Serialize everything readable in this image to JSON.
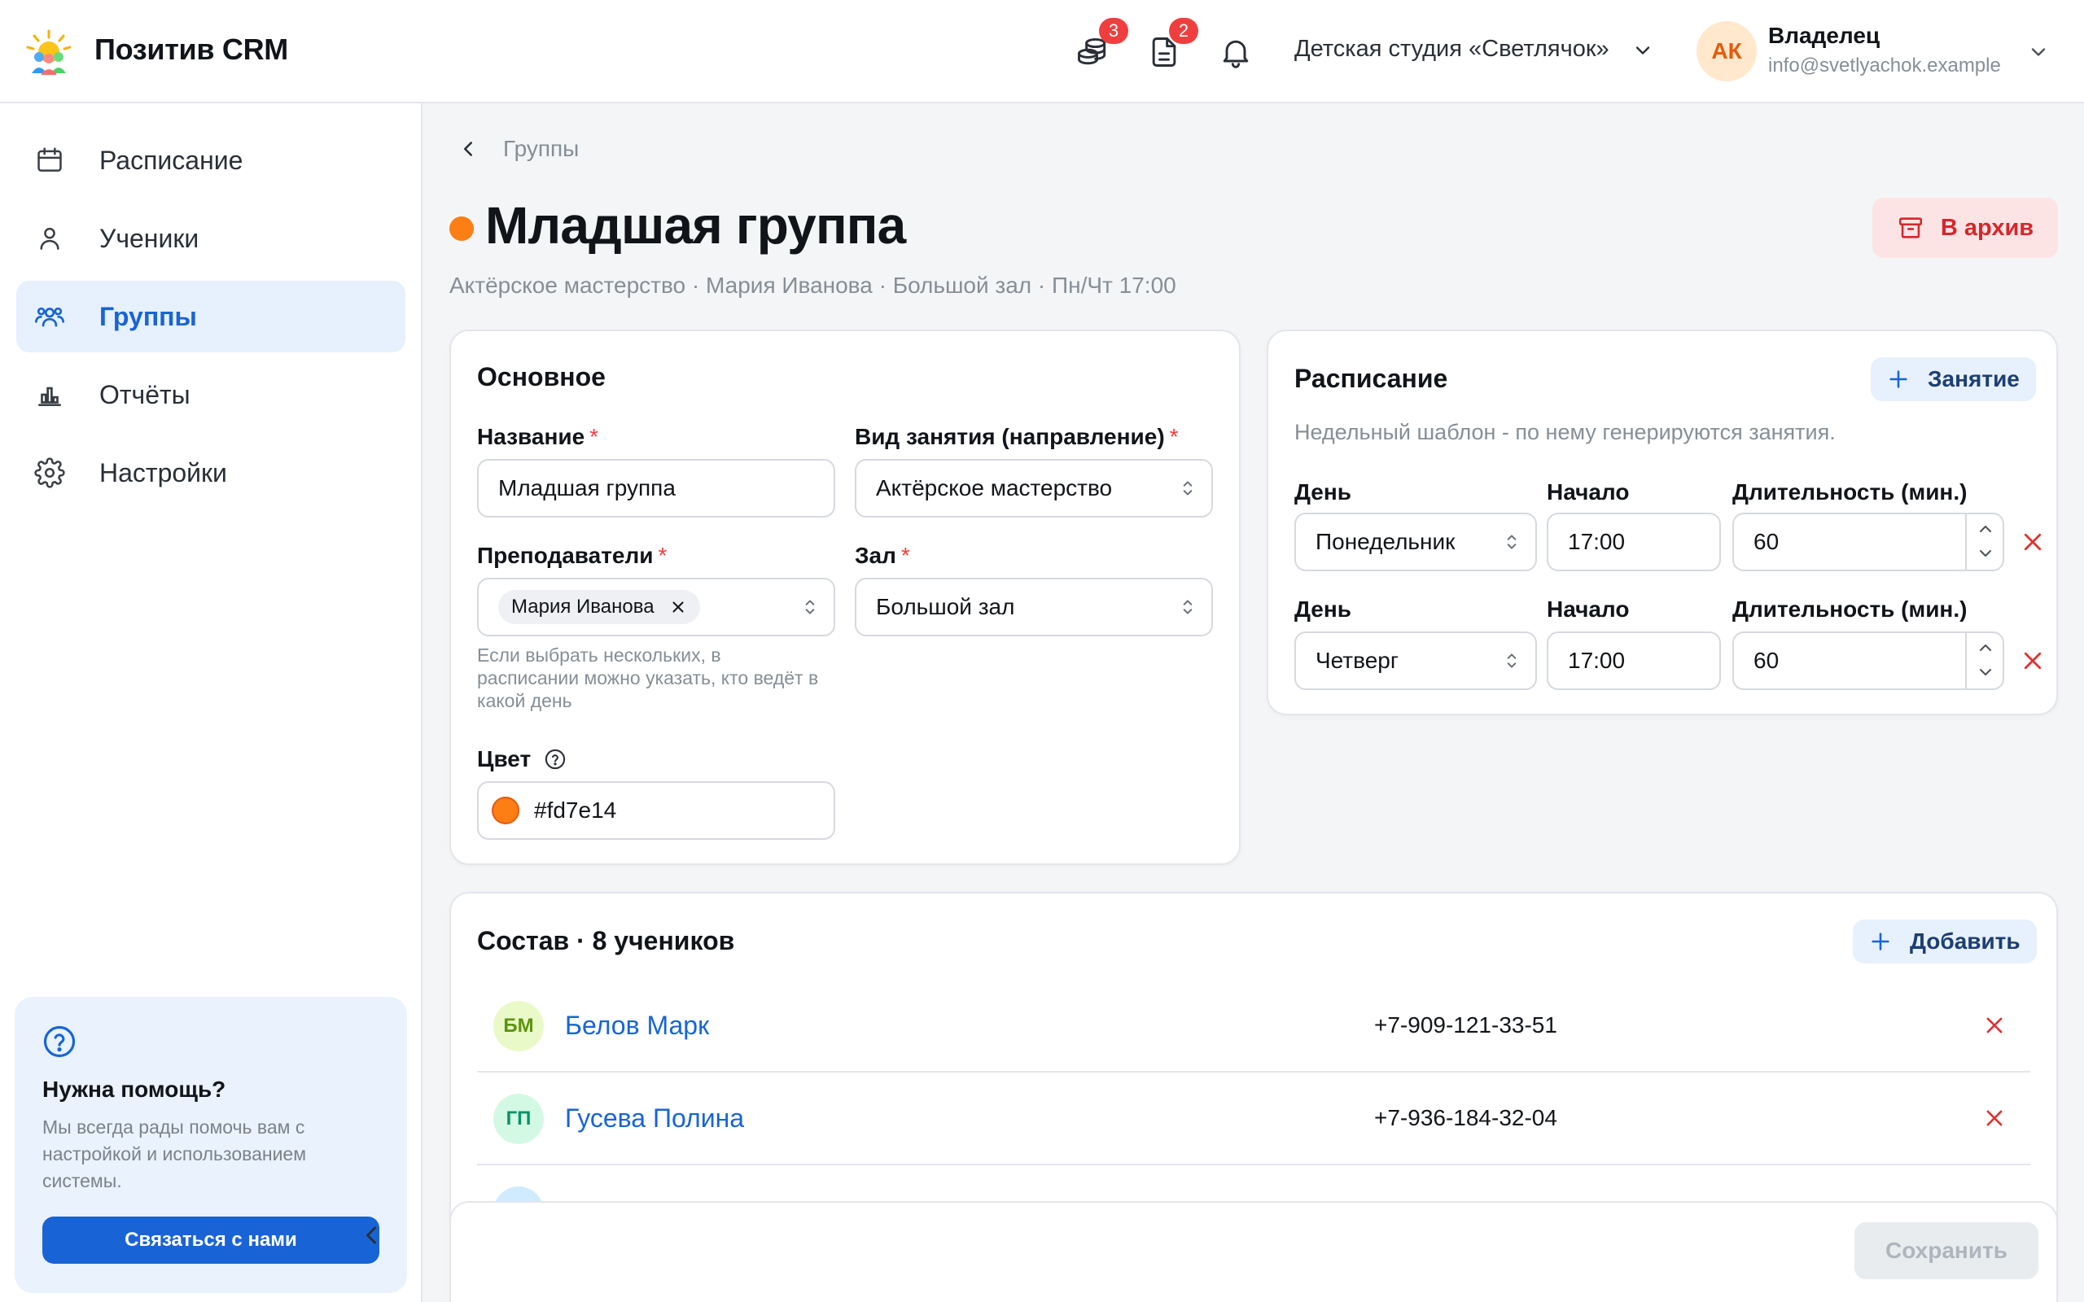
{
  "app": {
    "brand": "Позитив CRM"
  },
  "header": {
    "icons": [
      {
        "icon": "coins-icon",
        "badge": "3"
      },
      {
        "icon": "document-icon",
        "badge": "2"
      },
      {
        "icon": "bell-icon"
      }
    ],
    "studio": "Детская студия «Светлячок»",
    "user": {
      "initials": "АК",
      "role": "Владелец",
      "email": "info@svetlyachok.example"
    }
  },
  "sidebar": {
    "items": [
      {
        "label": "Расписание",
        "icon": "calendar-icon",
        "active": false
      },
      {
        "label": "Ученики",
        "icon": "user-icon",
        "active": false
      },
      {
        "label": "Группы",
        "icon": "users-icon",
        "active": true
      },
      {
        "label": "Отчёты",
        "icon": "bar-chart-icon",
        "active": false
      },
      {
        "label": "Настройки",
        "icon": "gear-icon",
        "active": false
      }
    ],
    "help": {
      "title": "Нужна помощь?",
      "text": "Мы всегда рады помочь вам с настройкой и использованием системы.",
      "button": "Связаться с нами"
    }
  },
  "breadcrumb": {
    "back": "Группы"
  },
  "page": {
    "title": "Младшая группа",
    "color": "#fd7e14",
    "subtitle": "Актёрское мастерство · Мария Иванова · Большой зал · Пн/Чт 17:00",
    "archive_button": "В архив"
  },
  "basic": {
    "title": "Основное",
    "name_label": "Название",
    "name_value": "Младшая группа",
    "type_label": "Вид занятия (направление)",
    "type_value": "Актёрское мастерство",
    "teachers_label": "Преподаватели",
    "teacher_chip": "Мария Иванова",
    "teachers_hint": "Если выбрать нескольких, в расписании можно указать, кто ведёт в какой день",
    "hall_label": "Зал",
    "hall_value": "Большой зал",
    "color_label": "Цвет",
    "color_value": "#fd7e14"
  },
  "schedule": {
    "title": "Расписание",
    "add_button": "Занятие",
    "description": "Недельный шаблон - по нему генерируются занятия.",
    "day_label": "День",
    "start_label": "Начало",
    "duration_label": "Длительность (мин.)",
    "rows": [
      {
        "day": "Понедельник",
        "start": "17:00",
        "duration": "60"
      },
      {
        "day": "Четверг",
        "start": "17:00",
        "duration": "60"
      }
    ]
  },
  "members": {
    "title": "Состав · 8 учеников",
    "add_button": "Добавить",
    "rows": [
      {
        "initials": "БМ",
        "name": "Белов Марк",
        "phone": "+7-909-121-33-51",
        "avatar_bg": "#e9fac8",
        "avatar_fg": "#5c940d"
      },
      {
        "initials": "ГП",
        "name": "Гусева Полина",
        "phone": "+7-936-184-32-04",
        "avatar_bg": "#d3f9e4",
        "avatar_fg": "#099268"
      }
    ]
  },
  "footer": {
    "save_button": "Сохранить"
  }
}
